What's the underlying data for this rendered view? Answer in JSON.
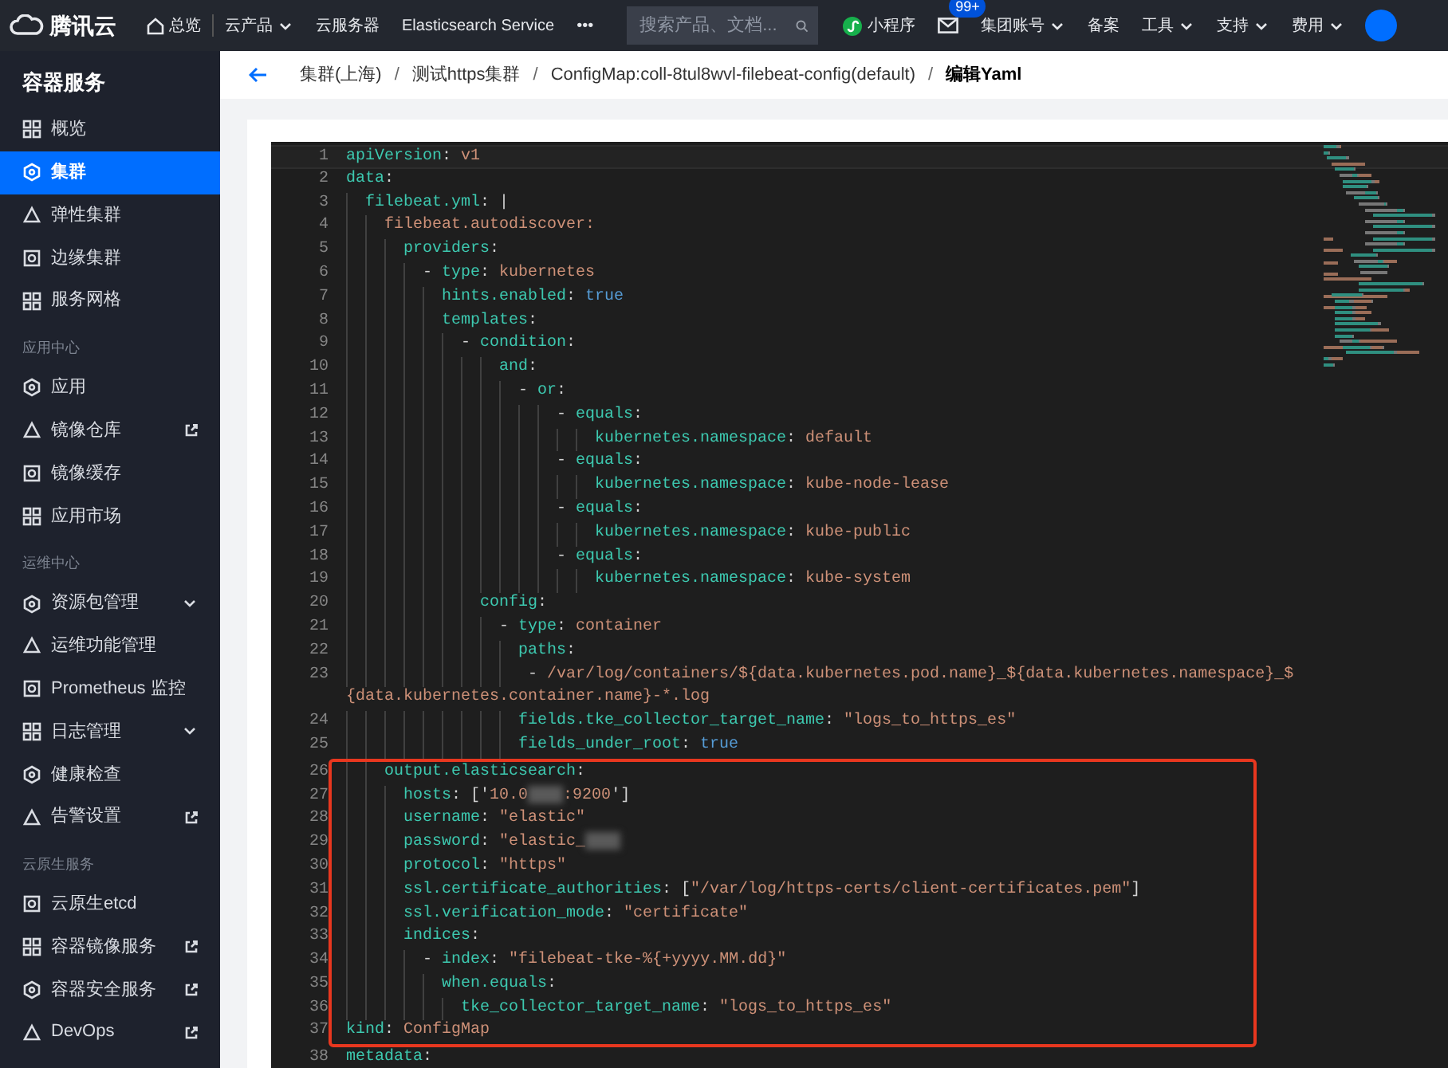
{
  "topbar": {
    "brand": "腾讯云",
    "items": [
      {
        "kind": "home",
        "label": "总览"
      },
      {
        "kind": "menu",
        "label": "云产品"
      },
      {
        "kind": "link",
        "label": "云服务器"
      },
      {
        "kind": "link",
        "label": "Elasticsearch Service"
      },
      {
        "kind": "more",
        "label": "•••"
      }
    ],
    "search": {
      "placeholder": "搜索产品、文档..."
    },
    "right": [
      {
        "kind": "miniapp",
        "label": "小程序"
      },
      {
        "kind": "mail",
        "badge": "99+"
      },
      {
        "kind": "menu",
        "label": "集团账号"
      },
      {
        "kind": "link",
        "label": "备案"
      },
      {
        "kind": "menu",
        "label": "工具"
      },
      {
        "kind": "menu",
        "label": "支持"
      },
      {
        "kind": "menu",
        "label": "费用"
      },
      {
        "kind": "avatar"
      }
    ]
  },
  "sidebar": {
    "title": "容器服务",
    "sections": [
      {
        "items": [
          {
            "label": "概览",
            "selected": false,
            "external": false,
            "submenu": false
          },
          {
            "label": "集群",
            "selected": true,
            "external": false,
            "submenu": false
          },
          {
            "label": "弹性集群",
            "selected": false,
            "external": false,
            "submenu": false
          },
          {
            "label": "边缘集群",
            "selected": false,
            "external": false,
            "submenu": false
          },
          {
            "label": "服务网格",
            "selected": false,
            "external": false,
            "submenu": false
          }
        ]
      },
      {
        "heading": "应用中心",
        "items": [
          {
            "label": "应用",
            "selected": false,
            "external": false,
            "submenu": false
          },
          {
            "label": "镜像仓库",
            "selected": false,
            "external": true,
            "submenu": false
          },
          {
            "label": "镜像缓存",
            "selected": false,
            "external": false,
            "submenu": false
          },
          {
            "label": "应用市场",
            "selected": false,
            "external": false,
            "submenu": false
          }
        ]
      },
      {
        "heading": "运维中心",
        "items": [
          {
            "label": "资源包管理",
            "selected": false,
            "external": false,
            "submenu": true
          },
          {
            "label": "运维功能管理",
            "selected": false,
            "external": false,
            "submenu": false
          },
          {
            "label": "Prometheus 监控",
            "selected": false,
            "external": false,
            "submenu": false
          },
          {
            "label": "日志管理",
            "selected": false,
            "external": false,
            "submenu": true
          },
          {
            "label": "健康检查",
            "selected": false,
            "external": false,
            "submenu": false
          },
          {
            "label": "告警设置",
            "selected": false,
            "external": true,
            "submenu": false
          }
        ]
      },
      {
        "heading": "云原生服务",
        "items": [
          {
            "label": "云原生etcd",
            "selected": false,
            "external": false,
            "submenu": false
          },
          {
            "label": "容器镜像服务",
            "selected": false,
            "external": true,
            "submenu": false
          },
          {
            "label": "容器安全服务",
            "selected": false,
            "external": true,
            "submenu": false
          },
          {
            "label": "DevOps",
            "selected": false,
            "external": true,
            "submenu": false
          }
        ]
      }
    ]
  },
  "breadcrumb_separators": [
    "/",
    "/",
    "/"
  ],
  "breadcrumb": [
    {
      "label": "集群(上海)",
      "current": false
    },
    {
      "label": "测试https集群",
      "current": false
    },
    {
      "label": "ConfigMap:coll-8tul8wvl-filebeat-config(default)",
      "current": false
    },
    {
      "label": "编辑Yaml",
      "current": true
    }
  ],
  "editor": {
    "blocks": [
      {
        "framed": false,
        "lines": [
          {
            "number": "1",
            "tokens": [
              {
                "kind": "key",
                "text": "apiVersion"
              },
              {
                "kind": "punct",
                "text": ": "
              },
              {
                "kind": "str",
                "text": "v1"
              }
            ]
          },
          {
            "number": "2",
            "tokens": [
              {
                "kind": "key",
                "text": "data"
              },
              {
                "kind": "punct",
                "text": ":"
              }
            ]
          },
          {
            "number": "3",
            "tokens": [
              {
                "kind": "key",
                "text": "  filebeat.yml"
              },
              {
                "kind": "punct",
                "text": ": |"
              }
            ]
          },
          {
            "number": "4",
            "tokens": [
              {
                "kind": "str",
                "text": "    filebeat.autodiscover:"
              }
            ]
          },
          {
            "number": "5",
            "tokens": [
              {
                "kind": "key",
                "text": "      providers"
              },
              {
                "kind": "punct",
                "text": ":"
              }
            ]
          },
          {
            "number": "6",
            "tokens": [
              {
                "kind": "punct",
                "text": "        - "
              },
              {
                "kind": "key",
                "text": "type"
              },
              {
                "kind": "punct",
                "text": ": "
              },
              {
                "kind": "str",
                "text": "kubernetes"
              }
            ]
          },
          {
            "number": "7",
            "tokens": [
              {
                "kind": "key",
                "text": "          hints.enabled"
              },
              {
                "kind": "punct",
                "text": ": "
              },
              {
                "kind": "bool",
                "text": "true"
              }
            ]
          },
          {
            "number": "8",
            "tokens": [
              {
                "kind": "key",
                "text": "          templates"
              },
              {
                "kind": "punct",
                "text": ":"
              }
            ]
          },
          {
            "number": "9",
            "tokens": [
              {
                "kind": "punct",
                "text": "            - "
              },
              {
                "kind": "key",
                "text": "condition"
              },
              {
                "kind": "punct",
                "text": ":"
              }
            ]
          },
          {
            "number": "10",
            "tokens": [
              {
                "kind": "key",
                "text": "                and"
              },
              {
                "kind": "punct",
                "text": ":"
              }
            ]
          },
          {
            "number": "11",
            "tokens": [
              {
                "kind": "punct",
                "text": "                  - "
              },
              {
                "kind": "key",
                "text": "or"
              },
              {
                "kind": "punct",
                "text": ":"
              }
            ]
          },
          {
            "number": "12",
            "tokens": [
              {
                "kind": "punct",
                "text": "                      - "
              },
              {
                "kind": "key",
                "text": "equals"
              },
              {
                "kind": "punct",
                "text": ":"
              }
            ]
          },
          {
            "number": "13",
            "tokens": [
              {
                "kind": "key",
                "text": "                          kubernetes.namespace"
              },
              {
                "kind": "punct",
                "text": ": "
              },
              {
                "kind": "str",
                "text": "default"
              }
            ]
          },
          {
            "number": "14",
            "tokens": [
              {
                "kind": "punct",
                "text": "                      - "
              },
              {
                "kind": "key",
                "text": "equals"
              },
              {
                "kind": "punct",
                "text": ":"
              }
            ]
          },
          {
            "number": "15",
            "tokens": [
              {
                "kind": "key",
                "text": "                          kubernetes.namespace"
              },
              {
                "kind": "punct",
                "text": ": "
              },
              {
                "kind": "str",
                "text": "kube-node-lease"
              }
            ]
          },
          {
            "number": "16",
            "tokens": [
              {
                "kind": "punct",
                "text": "                      - "
              },
              {
                "kind": "key",
                "text": "equals"
              },
              {
                "kind": "punct",
                "text": ":"
              }
            ]
          },
          {
            "number": "17",
            "tokens": [
              {
                "kind": "key",
                "text": "                          kubernetes.namespace"
              },
              {
                "kind": "punct",
                "text": ": "
              },
              {
                "kind": "str",
                "text": "kube-public"
              }
            ]
          },
          {
            "number": "18",
            "tokens": [
              {
                "kind": "punct",
                "text": "                      - "
              },
              {
                "kind": "key",
                "text": "equals"
              },
              {
                "kind": "punct",
                "text": ":"
              }
            ]
          },
          {
            "number": "19",
            "tokens": [
              {
                "kind": "key",
                "text": "                          kubernetes.namespace"
              },
              {
                "kind": "punct",
                "text": ": "
              },
              {
                "kind": "str",
                "text": "kube-system"
              }
            ]
          },
          {
            "number": "20",
            "tokens": [
              {
                "kind": "key",
                "text": "              config"
              },
              {
                "kind": "punct",
                "text": ":"
              }
            ]
          },
          {
            "number": "21",
            "tokens": [
              {
                "kind": "punct",
                "text": "                - "
              },
              {
                "kind": "key",
                "text": "type"
              },
              {
                "kind": "punct",
                "text": ": "
              },
              {
                "kind": "str",
                "text": "container"
              }
            ]
          },
          {
            "number": "22",
            "tokens": [
              {
                "kind": "key",
                "text": "                  paths"
              },
              {
                "kind": "punct",
                "text": ":"
              }
            ]
          },
          {
            "number": "23",
            "tokens": [
              {
                "kind": "punct",
                "text": "                   - "
              },
              {
                "kind": "str",
                "text": "/var/log/containers/${data.kubernetes.pod.name}_${data.kubernetes.namespace}_$"
              }
            ]
          },
          {
            "tokens": [
              {
                "kind": "str",
                "text": "{data.kubernetes.container.name}-*.log"
              }
            ]
          },
          {
            "number": "24",
            "tokens": [
              {
                "kind": "key",
                "text": "                  fields.tke_collector_target_name"
              },
              {
                "kind": "punct",
                "text": ": "
              },
              {
                "kind": "str",
                "text": "\"logs_to_https_es\""
              }
            ]
          },
          {
            "number": "25",
            "tokens": [
              {
                "kind": "key",
                "text": "                  fields_under_root"
              },
              {
                "kind": "punct",
                "text": ": "
              },
              {
                "kind": "bool",
                "text": "true"
              }
            ]
          }
        ]
      },
      {
        "framed": true,
        "lines": [
          {
            "number": "26",
            "tokens": [
              {
                "kind": "key",
                "text": "    output.elasticsearch"
              },
              {
                "kind": "punct",
                "text": ":"
              }
            ]
          },
          {
            "number": "27",
            "tokens": [
              {
                "kind": "key",
                "text": "      hosts"
              },
              {
                "kind": "punct",
                "text": ": ['"
              },
              {
                "kind": "str",
                "text": "10.0"
              },
              {
                "kind": "redacted"
              },
              {
                "kind": "str",
                "text": ":9200"
              },
              {
                "kind": "punct",
                "text": "']"
              }
            ]
          },
          {
            "number": "28",
            "tokens": [
              {
                "kind": "key",
                "text": "      username"
              },
              {
                "kind": "punct",
                "text": ": "
              },
              {
                "kind": "str",
                "text": "\"elastic\""
              }
            ]
          },
          {
            "number": "29",
            "tokens": [
              {
                "kind": "key",
                "text": "      password"
              },
              {
                "kind": "punct",
                "text": ": "
              },
              {
                "kind": "str",
                "text": "\"elastic_"
              },
              {
                "kind": "redacted"
              }
            ]
          },
          {
            "number": "30",
            "tokens": [
              {
                "kind": "key",
                "text": "      protocol"
              },
              {
                "kind": "punct",
                "text": ": "
              },
              {
                "kind": "str",
                "text": "\"https\""
              }
            ]
          },
          {
            "number": "31",
            "tokens": [
              {
                "kind": "key",
                "text": "      ssl.certificate_authorities"
              },
              {
                "kind": "punct",
                "text": ": ["
              },
              {
                "kind": "str",
                "text": "\"/var/log/https-certs/client-certificates.pem\""
              },
              {
                "kind": "punct",
                "text": "]"
              }
            ]
          },
          {
            "number": "32",
            "tokens": [
              {
                "kind": "key",
                "text": "      ssl.verification_mode"
              },
              {
                "kind": "punct",
                "text": ": "
              },
              {
                "kind": "str",
                "text": "\"certificate\""
              }
            ]
          },
          {
            "number": "33",
            "tokens": [
              {
                "kind": "key",
                "text": "      indices"
              },
              {
                "kind": "punct",
                "text": ":"
              }
            ]
          },
          {
            "number": "34",
            "tokens": [
              {
                "kind": "punct",
                "text": "        - "
              },
              {
                "kind": "key",
                "text": "index"
              },
              {
                "kind": "punct",
                "text": ": "
              },
              {
                "kind": "str",
                "text": "\"filebeat-tke-%{+yyyy.MM.dd}\""
              }
            ]
          },
          {
            "number": "35",
            "tokens": [
              {
                "kind": "key",
                "text": "          when.equals"
              },
              {
                "kind": "punct",
                "text": ":"
              }
            ]
          },
          {
            "number": "36",
            "tokens": [
              {
                "kind": "key",
                "text": "            tke_collector_target_name"
              },
              {
                "kind": "punct",
                "text": ": "
              },
              {
                "kind": "str",
                "text": "\"logs_to_https_es\""
              }
            ]
          },
          {
            "number": "37",
            "tokens": [
              {
                "kind": "key",
                "text": "kind"
              },
              {
                "kind": "punct",
                "text": ": "
              },
              {
                "kind": "str",
                "text": "ConfigMap"
              }
            ]
          }
        ]
      },
      {
        "framed": false,
        "lines": [
          {
            "number": "38",
            "tokens": [
              {
                "kind": "key",
                "text": "metadata"
              },
              {
                "kind": "punct",
                "text": ":"
              }
            ]
          }
        ]
      }
    ]
  }
}
